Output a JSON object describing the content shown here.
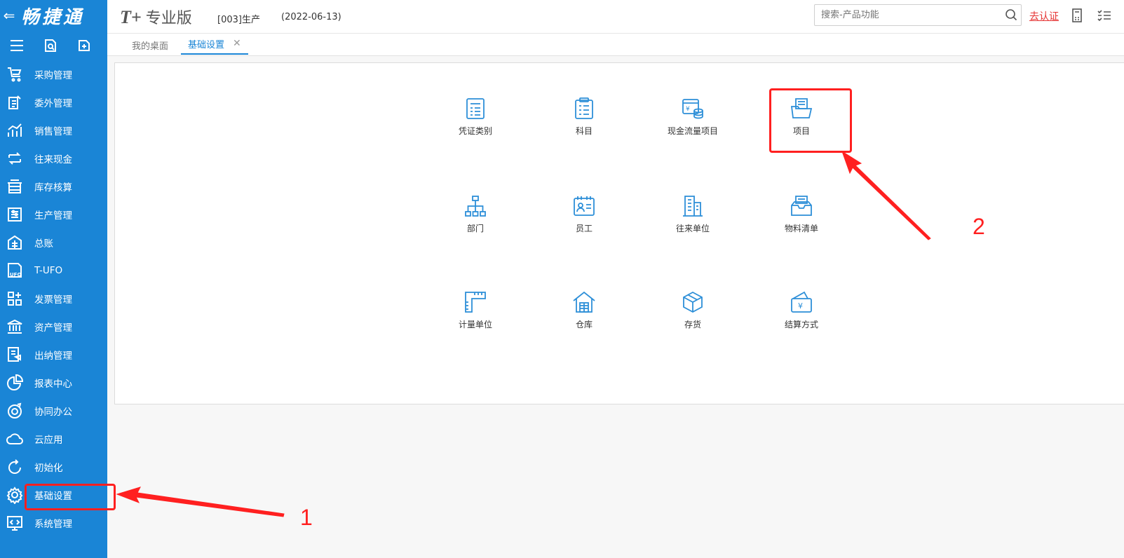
{
  "brand": {
    "back_glyph": "⇐",
    "name": "畅捷通"
  },
  "sidebar": {
    "items": [
      {
        "label": "采购管理",
        "icon": "cart-icon"
      },
      {
        "label": "委外管理",
        "icon": "outsource-icon"
      },
      {
        "label": "销售管理",
        "icon": "sales-chart-icon"
      },
      {
        "label": "往来现金",
        "icon": "exchange-icon"
      },
      {
        "label": "库存核算",
        "icon": "inventory-icon"
      },
      {
        "label": "生产管理",
        "icon": "production-icon"
      },
      {
        "label": "总账",
        "icon": "ledger-icon"
      },
      {
        "label": "T-UFO",
        "icon": "ufo-icon"
      },
      {
        "label": "发票管理",
        "icon": "invoice-icon"
      },
      {
        "label": "资产管理",
        "icon": "bank-icon"
      },
      {
        "label": "出纳管理",
        "icon": "cashier-icon"
      },
      {
        "label": "报表中心",
        "icon": "pie-chart-icon"
      },
      {
        "label": "协同办公",
        "icon": "collab-icon"
      },
      {
        "label": "云应用",
        "icon": "cloud-icon"
      },
      {
        "label": "初始化",
        "icon": "refresh-icon"
      },
      {
        "label": "基础设置",
        "icon": "gear-icon"
      },
      {
        "label": "系统管理",
        "icon": "system-icon"
      }
    ]
  },
  "header": {
    "logo_mark": "T+",
    "logo_edition": "专业版",
    "company": "[003]生产",
    "date": "(2022-06-13)",
    "search_placeholder": "搜索-产品功能",
    "cert_link": "去认证"
  },
  "tabs": {
    "desktop": "我的桌面",
    "basic": "基础设置",
    "close": "✕"
  },
  "grid": {
    "items": [
      {
        "label": "凭证类别",
        "icon": "voucher-icon"
      },
      {
        "label": "科目",
        "icon": "subject-icon"
      },
      {
        "label": "现金流量项目",
        "icon": "cashflow-icon"
      },
      {
        "label": "项目",
        "icon": "project-folder-icon"
      },
      {
        "label": "部门",
        "icon": "org-chart-icon"
      },
      {
        "label": "员工",
        "icon": "employee-card-icon"
      },
      {
        "label": "往来单位",
        "icon": "building-icon"
      },
      {
        "label": "物料清单",
        "icon": "material-tray-icon"
      },
      {
        "label": "计量单位",
        "icon": "ruler-icon"
      },
      {
        "label": "仓库",
        "icon": "warehouse-icon"
      },
      {
        "label": "存货",
        "icon": "box-icon"
      },
      {
        "label": "结算方式",
        "icon": "payment-icon"
      }
    ]
  },
  "annotations": {
    "step1": "1",
    "step2": "2"
  },
  "colors": {
    "sidebar": "#1a85d6",
    "accent": "#1a85d6",
    "highlight": "#ff2020"
  }
}
